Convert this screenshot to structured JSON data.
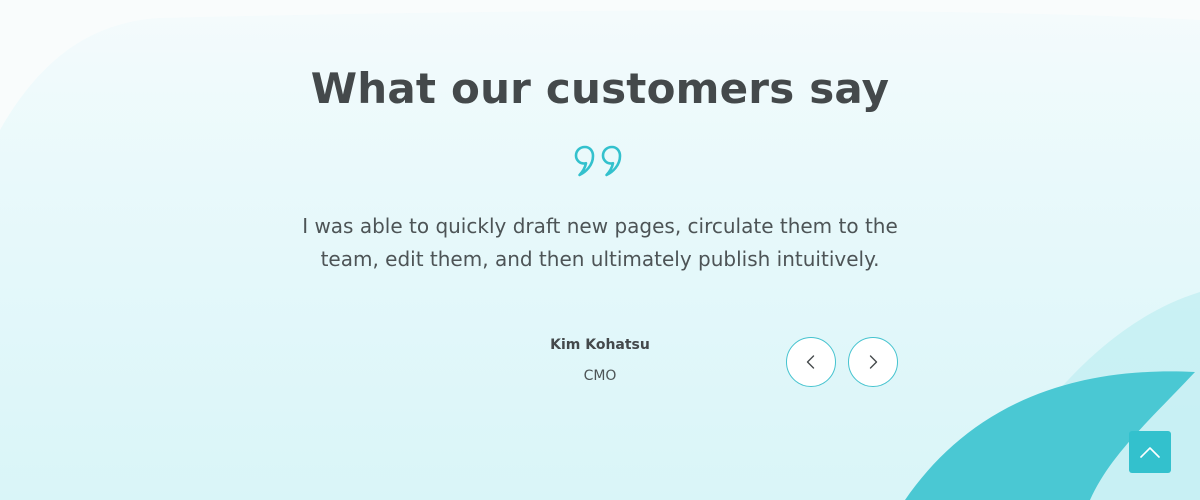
{
  "section": {
    "title": "What our customers say"
  },
  "testimonial": {
    "quote": "I was able to quickly draft new pages, circulate them to the team, edit them, and then ultimately publish intuitively.",
    "author_name": "Kim Kohatsu",
    "author_role": "CMO"
  },
  "icons": {
    "quote": "quote-mark-icon",
    "prev": "chevron-left-icon",
    "next": "chevron-right-icon",
    "scroll_top": "chevron-up-icon"
  },
  "colors": {
    "accent": "#33c1cd",
    "heading": "#44494b",
    "body_text": "#4d5456",
    "blob": "#4ac8d3"
  }
}
